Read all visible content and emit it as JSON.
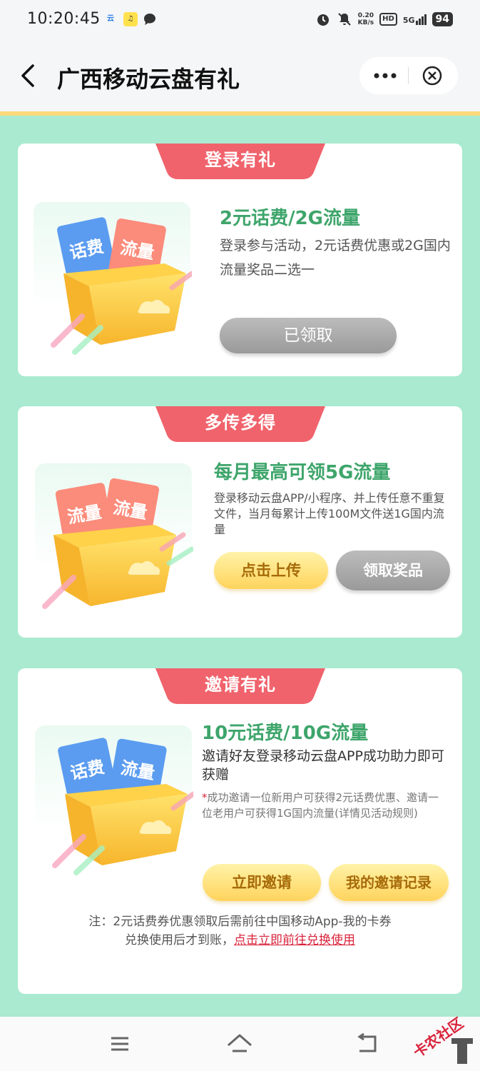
{
  "status_bar": {
    "time": "10:20:45",
    "net_speed_value": "0.20",
    "net_speed_unit": "KB/s",
    "hd_label": "HD",
    "signal_label": "5G",
    "battery": "94"
  },
  "header": {
    "title": "广西移动云盘有礼"
  },
  "cards": [
    {
      "tab_label": "登录有礼",
      "prize_title": "2元话费/2G流量",
      "desc": "登录参与活动，2元话费优惠或2G国内流量奖品二选一",
      "button": "已领取",
      "tickets": [
        "话费",
        "流量"
      ]
    },
    {
      "tab_label": "多传多得",
      "prize_title": "每月最高可领5G流量",
      "desc": "登录移动云盘APP/小程序、并上传任意不重复文件，当月每累计上传100M文件送1G国内流量",
      "button_primary": "点击上传",
      "button_secondary": "领取奖品",
      "tickets": [
        "流量",
        "流量"
      ]
    },
    {
      "tab_label": "邀请有礼",
      "prize_title": "10元话费/10G流量",
      "desc": "邀请好友登录移动云盘APP成功助力即可获赠",
      "warning": "成功邀请一位新用户可获得2元话费优惠、邀请一位老用户可获得1G国内流量(详情见活动规则)",
      "button_primary": "立即邀请",
      "button_secondary": "我的邀请记录",
      "tickets": [
        "话费",
        "流量"
      ]
    }
  ],
  "note": {
    "prefix": "注：2元话费券优惠领取后需前往中国移动App-我的卡券",
    "line2": "兑换使用后才到账，",
    "link": "点击立即前往兑换使用"
  },
  "ticket_sub": "奖品",
  "watermark_text": "卡农社区",
  "colors": {
    "background": "#a9ead0",
    "accent_green": "#3ea56b",
    "tab_red": "#f0636c",
    "link_red": "#d9233b"
  }
}
